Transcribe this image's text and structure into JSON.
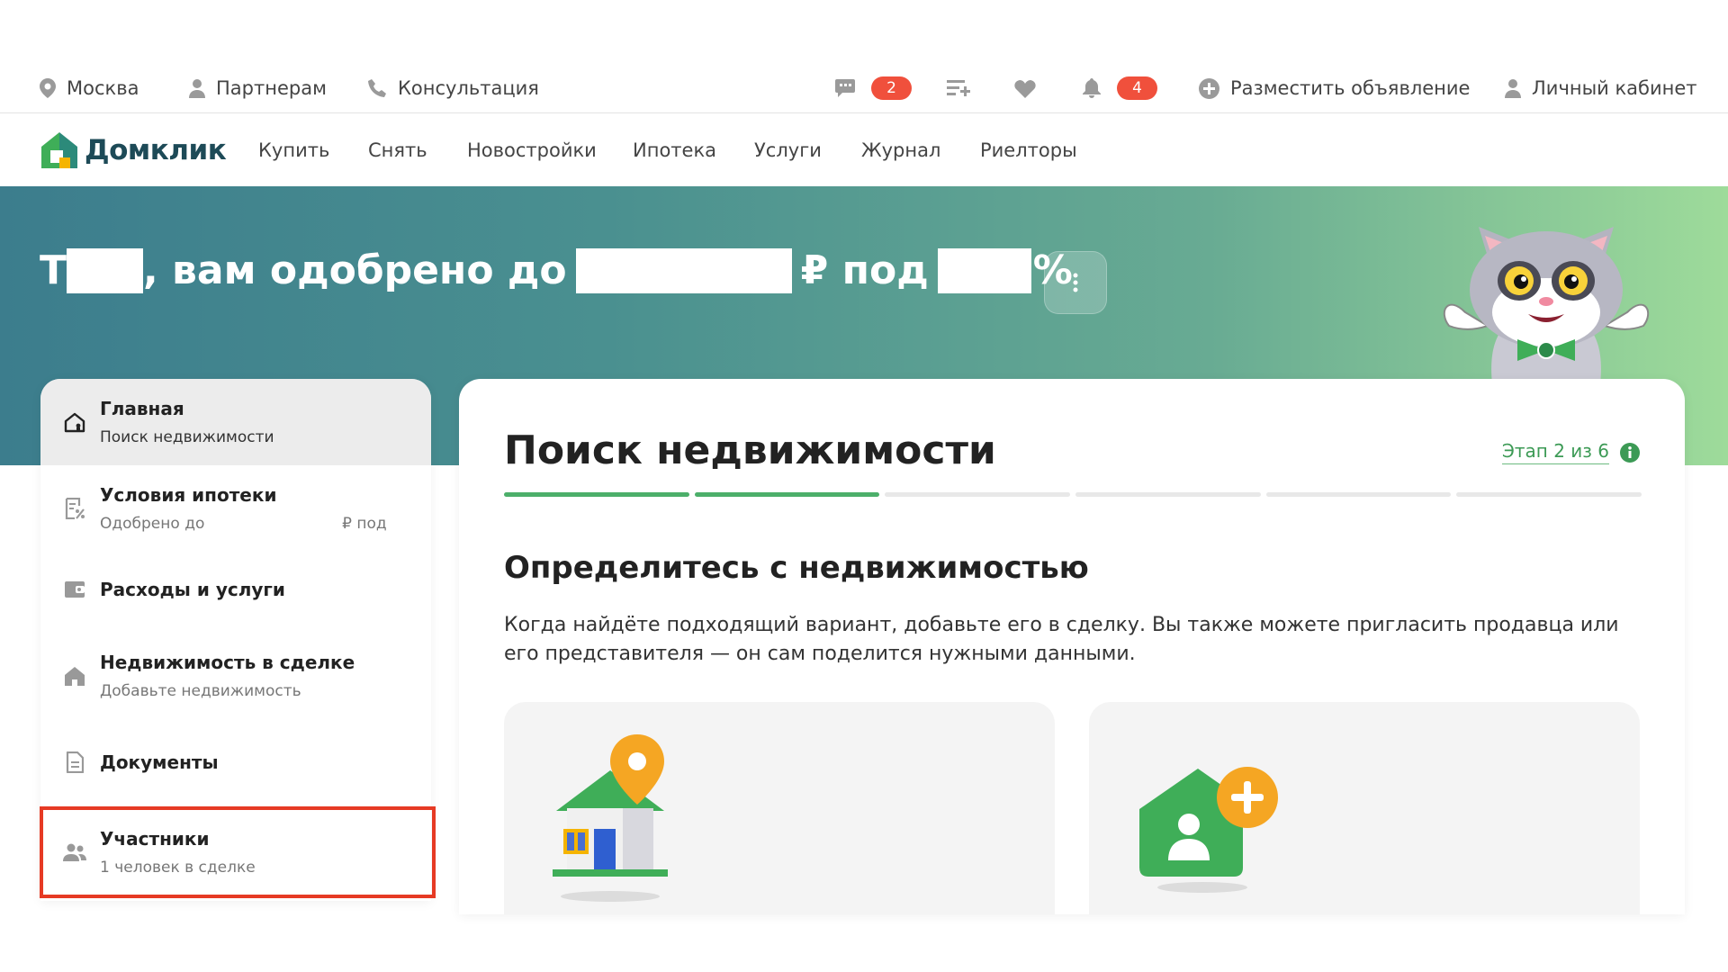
{
  "topbar": {
    "city": "Москва",
    "partners": "Партнерам",
    "consultation": "Консультация",
    "messages_count": "2",
    "notifications_count": "4",
    "post_ad": "Разместить объявление",
    "account": "Личный кабинет"
  },
  "nav": {
    "logo": "Домклик",
    "items": [
      "Купить",
      "Снять",
      "Новостройки",
      "Ипотека",
      "Услуги",
      "Журнал",
      "Риелторы"
    ]
  },
  "hero": {
    "name_initial": "Т",
    "approved_text": ", вам одобрено до",
    "currency_text": "₽ под",
    "percent_text": "%"
  },
  "sidebar": {
    "items": [
      {
        "title": "Главная",
        "subtitle": "Поиск недвижимости",
        "icon": "home-outline-icon"
      },
      {
        "title": "Условия ипотеки",
        "subtitle_a": "Одобрено до",
        "subtitle_b": "₽ под",
        "subtitle_c": "%",
        "icon": "percent-doc-icon"
      },
      {
        "title": "Расходы и услуги",
        "icon": "wallet-icon"
      },
      {
        "title": "Недвижимость в сделке",
        "subtitle": "Добавьте недвижимость",
        "icon": "house-icon"
      },
      {
        "title": "Документы",
        "icon": "document-icon"
      },
      {
        "title": "Участники",
        "subtitle": "1 человек в сделке",
        "icon": "people-icon"
      }
    ]
  },
  "main": {
    "title": "Поиск недвижимости",
    "stage": "Этап 2 из 6",
    "progress": {
      "completed": 2,
      "total": 6
    },
    "section_title": "Определитесь с недвижимостью",
    "section_desc": "Когда найдёте подходящий вариант, добавьте его в сделку. Вы также можете пригласить продавца или его представителя — он сам поделится нужными данными."
  },
  "colors": {
    "accent_green": "#4caf6a",
    "badge_red": "#f0503c",
    "highlight_red": "#e63a24",
    "logo_dark": "#1d4a57"
  }
}
